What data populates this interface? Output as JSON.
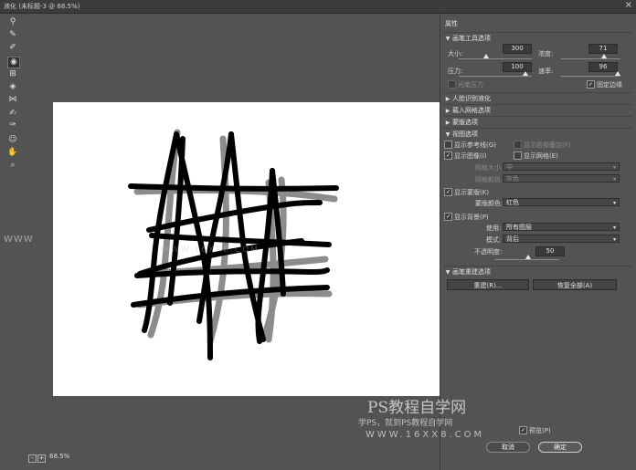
{
  "window": {
    "title": "液化 (未标题-3 @ 68.5%)",
    "close_glyph": "×"
  },
  "tools": [
    {
      "icon": "forward-warp-icon",
      "glyph": "⚲"
    },
    {
      "icon": "reconstruct-icon",
      "glyph": "✎"
    },
    {
      "icon": "smooth-icon",
      "glyph": "✐"
    },
    {
      "icon": "twirl-icon",
      "glyph": "◉"
    },
    {
      "icon": "pucker-icon",
      "glyph": "⊞"
    },
    {
      "icon": "bloat-icon",
      "glyph": "◈"
    },
    {
      "icon": "push-left-icon",
      "glyph": "⋈"
    },
    {
      "icon": "freeze-mask-icon",
      "glyph": "✍"
    },
    {
      "icon": "thaw-mask-icon",
      "glyph": "✑"
    },
    {
      "icon": "face-tool-icon",
      "glyph": "☺"
    },
    {
      "icon": "hand-icon",
      "glyph": "✋"
    },
    {
      "icon": "zoom-icon",
      "glyph": "⌕"
    }
  ],
  "statusbar": {
    "minus": "-",
    "plus": "+",
    "zoom": "68.5%"
  },
  "panel": {
    "title": "属性",
    "brush_tool": {
      "header": "画笔工具选项",
      "size_label": "大小:",
      "size": "300",
      "density_label": "浓度:",
      "density": "71",
      "pressure_label": "压力:",
      "pressure": "100",
      "rate_label": "速率:",
      "rate": "96",
      "stylus_label": "光笔压力",
      "pin_edges_label": "固定边缘"
    },
    "face_aware": "人脸识别液化",
    "load_mesh": "载入网格选项",
    "mask_options": "蒙版选项",
    "view": {
      "header": "视图选项",
      "show_guides": "显示参考线(G)",
      "show_face_overlay": "显示脸部叠加(F)",
      "show_image": "显示图像(I)",
      "show_mesh": "显示网格(E)",
      "mesh_size_label": "网格大小:",
      "mesh_size": "中",
      "mesh_color_label": "网格颜色:",
      "mesh_color": "灰色",
      "show_mask": "显示蒙版(K)",
      "mask_color_label": "蒙版颜色:",
      "mask_color": "红色",
      "show_backdrop": "显示背景(P)",
      "use_label": "使用:",
      "use": "所有图层",
      "mode_label": "模式:",
      "mode": "背后",
      "opacity_label": "不透明度:",
      "opacity": "50"
    },
    "reconstruct": {
      "header": "画笔重建选项",
      "reconstruct_btn": "重建(R)...",
      "restore_all_btn": "恢复全部(A)"
    },
    "preview_label": "预览(P)",
    "cancel": "取消",
    "ok": "确定",
    "check": "✓",
    "caret": "▾",
    "arrow_open": "▼",
    "arrow_closed": "▶"
  },
  "watermark": {
    "line1": "PS教程自学网",
    "line2": "学PS，就到PS教程自学网",
    "line3": "WWW.16XX8.COM",
    "left": "WWW"
  }
}
